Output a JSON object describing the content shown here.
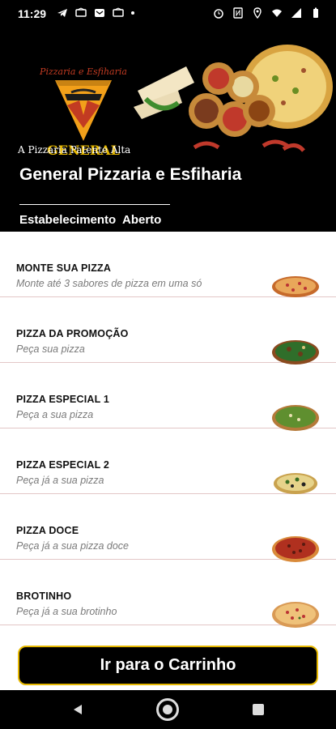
{
  "status_bar": {
    "time": "11:29",
    "left_icons": [
      "telegram-icon",
      "notification-icon",
      "mail-icon",
      "notification-icon",
      "dot-icon"
    ],
    "right_icons": [
      "alarm-icon",
      "nfc-icon",
      "location-icon",
      "wifi-icon",
      "signal-icon",
      "battery-icon"
    ]
  },
  "header": {
    "logo_top_text": "Pizzaria e Esfiharia",
    "logo_brand": "GENERAL",
    "slogan": "A Pizzaria Patente Alta",
    "title": "General Pizzaria e Esfiharia",
    "status_label": "Estabelecimento",
    "status_value": "Aberto"
  },
  "menu": {
    "items": [
      {
        "title": "MONTE SUA PIZZA",
        "subtitle": "Monte até 3 sabores de pizza em uma só"
      },
      {
        "title": "PIZZA DA PROMOÇÃO",
        "subtitle": "Peça sua pizza"
      },
      {
        "title": "PIZZA ESPECIAL 1",
        "subtitle": "Peça a sua pizza"
      },
      {
        "title": "PIZZA ESPECIAL 2",
        "subtitle": "Peça já a sua pizza"
      },
      {
        "title": "PIZZA DOCE",
        "subtitle": "Peça já  a sua pizza doce"
      },
      {
        "title": "BROTINHO",
        "subtitle": "Peça já  a sua brotinho"
      }
    ]
  },
  "cart_button": {
    "label": "Ir para o Carrinho"
  },
  "colors": {
    "accent_border": "#e6b800",
    "background": "#000000",
    "list_background": "#ffffff"
  }
}
